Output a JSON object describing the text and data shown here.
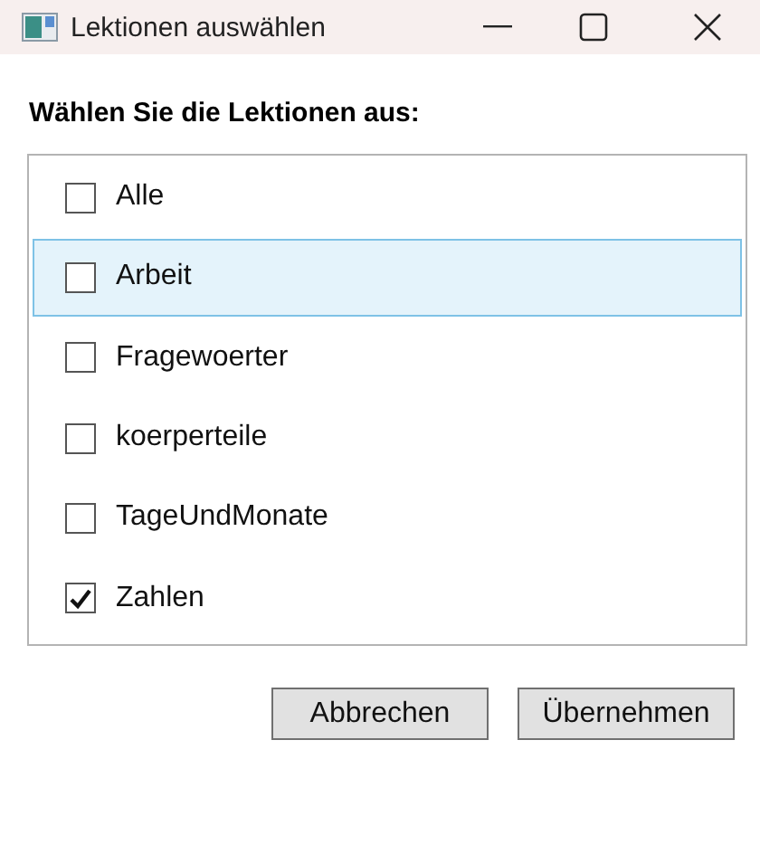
{
  "window": {
    "title": "Lektionen auswählen"
  },
  "heading": "Wählen Sie die Lektionen aus:",
  "lessons": [
    {
      "label": "Alle",
      "checked": false,
      "selected": false
    },
    {
      "label": "Arbeit",
      "checked": false,
      "selected": true
    },
    {
      "label": "Fragewoerter",
      "checked": false,
      "selected": false
    },
    {
      "label": "koerperteile",
      "checked": false,
      "selected": false
    },
    {
      "label": "TageUndMonate",
      "checked": false,
      "selected": false
    },
    {
      "label": "Zahlen",
      "checked": true,
      "selected": false
    }
  ],
  "buttons": [
    "Abbrechen",
    "Übernehmen"
  ]
}
